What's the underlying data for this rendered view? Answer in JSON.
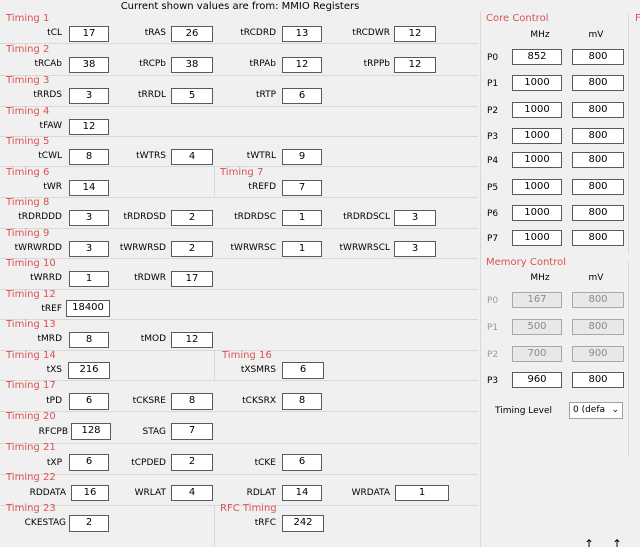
{
  "header": "Current shown values are from: MMIO Registers",
  "timings": {
    "timing1": {
      "title": "Timing 1",
      "tCL": "17",
      "tRAS": "26",
      "tRCDRD": "13",
      "tRCDWR": "12"
    },
    "timing2": {
      "title": "Timing 2",
      "tRCAb": "38",
      "tRCPb": "38",
      "tRPAb": "12",
      "tRPPb": "12"
    },
    "timing3": {
      "title": "Timing 3",
      "tRRDS": "3",
      "tRRDL": "5",
      "tRTP": "6"
    },
    "timing4": {
      "title": "Timing 4",
      "tFAW": "12"
    },
    "timing5": {
      "title": "Timing 5",
      "tCWL": "8",
      "tWTRS": "4",
      "tWTRL": "9"
    },
    "timing6": {
      "title": "Timing 6",
      "tWR": "14"
    },
    "timing7": {
      "title": "Timing 7",
      "tREFD": "7"
    },
    "timing8": {
      "title": "Timing 8",
      "tRDRDDD": "3",
      "tRDRDSD": "2",
      "tRDRDSC": "1",
      "tRDRDSCL": "3"
    },
    "timing9": {
      "title": "Timing 9",
      "tWRWRDD": "3",
      "tWRWRSD": "2",
      "tWRWRSC": "1",
      "tWRWRSCL": "3"
    },
    "timing10": {
      "title": "Timing 10",
      "tWRRD": "1",
      "tRDWR": "17"
    },
    "timing12": {
      "title": "Timing 12",
      "tREF": "18400"
    },
    "timing13": {
      "title": "Timing 13",
      "tMRD": "8",
      "tMOD": "12"
    },
    "timing14": {
      "title": "Timing 14",
      "tXS": "216"
    },
    "timing16": {
      "title": "Timing 16",
      "tXSMRS": "6"
    },
    "timing17": {
      "title": "Timing 17",
      "tPD": "6",
      "tCKSRE": "8",
      "tCKSRX": "8"
    },
    "timing20": {
      "title": "Timing 20",
      "RFCPB": "128",
      "STAG": "7"
    },
    "timing21": {
      "title": "Timing 21",
      "tXP": "6",
      "tCPDED": "2",
      "tCKE": "6"
    },
    "timing22": {
      "title": "Timing 22",
      "RDDATA": "16",
      "WRLAT": "4",
      "RDLAT": "14",
      "WRDATA": "1"
    },
    "timing23": {
      "title": "Timing 23",
      "CKESTAG": "2"
    },
    "rfc": {
      "title": "RFC Timing",
      "tRFC": "242"
    }
  },
  "labels": {
    "tCL": "tCL",
    "tRAS": "tRAS",
    "tRCDRD": "tRCDRD",
    "tRCDWR": "tRCDWR",
    "tRCAb": "tRCAb",
    "tRCPb": "tRCPb",
    "tRPAb": "tRPAb",
    "tRPPb": "tRPPb",
    "tRRDS": "tRRDS",
    "tRRDL": "tRRDL",
    "tRTP": "tRTP",
    "tFAW": "tFAW",
    "tCWL": "tCWL",
    "tWTRS": "tWTRS",
    "tWTRL": "tWTRL",
    "tWR": "tWR",
    "tREFD": "tREFD",
    "tRDRDDD": "tRDRDDD",
    "tRDRDSD": "tRDRDSD",
    "tRDRDSC": "tRDRDSC",
    "tRDRDSCL": "tRDRDSCL",
    "tWRWRDD": "tWRWRDD",
    "tWRWRSD": "tWRWRSD",
    "tWRWRSC": "tWRWRSC",
    "tWRWRSCL": "tWRWRSCL",
    "tWRRD": "tWRRD",
    "tRDWR": "tRDWR",
    "tREF": "tREF",
    "tMRD": "tMRD",
    "tMOD": "tMOD",
    "tXS": "tXS",
    "tXSMRS": "tXSMRS",
    "tPD": "tPD",
    "tCKSRE": "tCKSRE",
    "tCKSRX": "tCKSRX",
    "RFCPB": "RFCPB",
    "STAG": "STAG",
    "tXP": "tXP",
    "tCPDED": "tCPDED",
    "tCKE": "tCKE",
    "RDDATA": "RDDATA",
    "WRLAT": "WRLAT",
    "RDLAT": "RDLAT",
    "WRDATA": "WRDATA",
    "CKESTAG": "CKESTAG",
    "tRFC": "tRFC"
  },
  "core_control": {
    "title": "Core Control",
    "col_mhz": "MHz",
    "col_mv": "mV",
    "states": [
      {
        "label": "P0",
        "mhz": "852",
        "mv": "800"
      },
      {
        "label": "P1",
        "mhz": "1000",
        "mv": "800"
      },
      {
        "label": "P2",
        "mhz": "1000",
        "mv": "800"
      },
      {
        "label": "P3",
        "mhz": "1000",
        "mv": "800"
      },
      {
        "label": "P4",
        "mhz": "1000",
        "mv": "800"
      },
      {
        "label": "P5",
        "mhz": "1000",
        "mv": "800"
      },
      {
        "label": "P6",
        "mhz": "1000",
        "mv": "800"
      },
      {
        "label": "P7",
        "mhz": "1000",
        "mv": "800"
      }
    ]
  },
  "memory_control": {
    "title": "Memory Control",
    "col_mhz": "MHz",
    "col_mv": "mV",
    "states": [
      {
        "label": "P0",
        "mhz": "167",
        "mv": "800",
        "enabled": false
      },
      {
        "label": "P1",
        "mhz": "500",
        "mv": "800",
        "enabled": false
      },
      {
        "label": "P2",
        "mhz": "700",
        "mv": "900",
        "enabled": false
      },
      {
        "label": "P3",
        "mhz": "960",
        "mv": "800",
        "enabled": true
      }
    ],
    "timing_level_label": "Timing Level",
    "timing_level_value": "0 (defa"
  },
  "colors": {
    "section_title": "#d9534f",
    "background": "#f0f0f0"
  },
  "icons": [
    "arrow-icon",
    "arrow-icon"
  ]
}
